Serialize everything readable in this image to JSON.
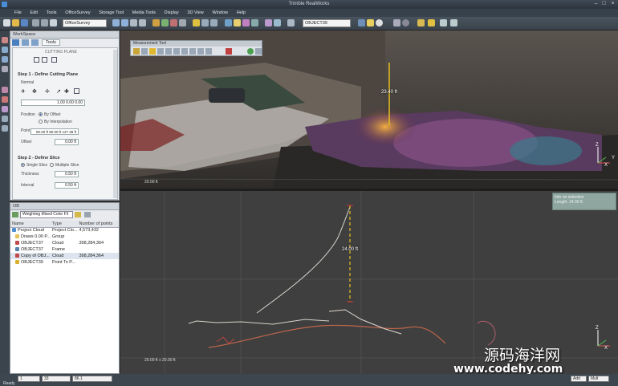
{
  "app": {
    "title": "Trimble RealWorks"
  },
  "menu": [
    "File",
    "Edit",
    "Tools",
    "OfficeSurvey",
    "Storage Tool",
    "Media Tools",
    "Display",
    "3D View",
    "Window",
    "Help"
  ],
  "toolbar": {
    "project_combo": "OfficeSurvey",
    "view_combo": "OBJECT39"
  },
  "workspace": {
    "title": "WorkSpace",
    "tab": "Tools",
    "subtitle": "CUTTING PLANE",
    "step1": "Step 1 - Define Cutting Plane",
    "normal_label": "Normal",
    "normal_value": "1.00 0.00 0.00",
    "position_label": "Position",
    "by_offset": "By Offset",
    "by_interpolation": "By Interpolation",
    "point_label": "Point",
    "point_value": "50.00 ft  80.00 ft  127.38 ft",
    "offset_label": "Offset",
    "offset_value": "0.00 ft",
    "step2": "Step 2 - Define Slice",
    "single_slice": "Single Slice",
    "multiple_slice": "Multiple Slice",
    "thickness_label": "Thickness",
    "thickness_value": "0.50 ft",
    "interval_label": "Interval",
    "interval_value": "0.50 ft"
  },
  "tree_panel": {
    "title": "OB",
    "combo": "Weighting Mixed Color Fil",
    "columns": [
      "Name",
      "Type",
      "Number of points"
    ],
    "rows": [
      {
        "name": "Project Cloud",
        "type": "Project Clo...",
        "points": "4,573,432"
      },
      {
        "name": "Draws 0.00 P...",
        "type": "Group",
        "points": ""
      },
      {
        "name": "OBJECT37",
        "type": "Cloud",
        "points": "398,284,364"
      },
      {
        "name": "OBJECT37",
        "type": "Frame",
        "points": ""
      },
      {
        "name": "Copy of OBJ...",
        "type": "Cloud",
        "points": "398,284,364"
      },
      {
        "name": "OBJECT39",
        "type": "Point To P...",
        "points": ""
      }
    ]
  },
  "top_view": {
    "toolbar_title": "Measurement Tool",
    "measure_label": "23.40 ft",
    "scale_label": "20.00 ft"
  },
  "bottom_view": {
    "measure_label": "24.00 ft",
    "scale_label": "20.00 ft x 20.00 ft",
    "info_title": "Info on selection",
    "info_value": "Length: 24.00 ft"
  },
  "axes": {
    "x": "X",
    "y": "Y",
    "z": "Z"
  },
  "status": {
    "left": "Ready",
    "field1": "1",
    "field2": "33",
    "field3": "86.1",
    "right1": "Add",
    "right2": "Mult"
  },
  "watermark": {
    "line1": "源码海洋网",
    "line2": "www.codehy.com"
  },
  "colors": {
    "accent": "#2a5db0",
    "measure_line": "#e8c020",
    "background": "#2b2b2b"
  }
}
